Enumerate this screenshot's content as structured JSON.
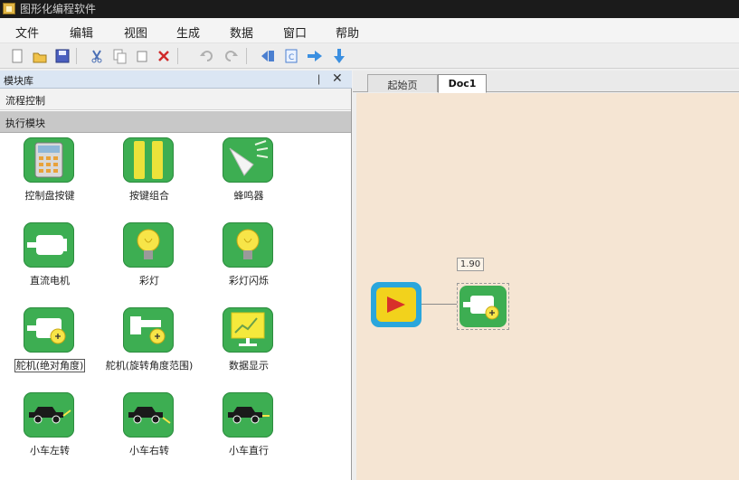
{
  "window": {
    "title": "图形化编程软件"
  },
  "menu": {
    "items": [
      "文件",
      "编辑",
      "视图",
      "生成",
      "数据",
      "窗口",
      "帮助"
    ]
  },
  "toolbar": {
    "buttons": [
      "new-file-icon",
      "open-file-icon",
      "save-icon",
      "cut-icon",
      "copy-icon",
      "paste-icon",
      "delete-icon",
      "undo-icon",
      "redo-icon",
      "import-icon",
      "export-icon",
      "arrow-right-icon",
      "arrow-down-icon"
    ]
  },
  "library": {
    "title": "模块库",
    "categories": [
      "流程控制",
      "执行模块"
    ],
    "modules": [
      {
        "label": "控制盘按键",
        "icon": "control-panel-icon"
      },
      {
        "label": "按键组合",
        "icon": "key-combo-icon"
      },
      {
        "label": "蜂鸣器",
        "icon": "buzzer-icon"
      },
      {
        "label": "直流电机",
        "icon": "dc-motor-icon"
      },
      {
        "label": "彩灯",
        "icon": "light-bulb-icon"
      },
      {
        "label": "彩灯闪烁",
        "icon": "light-blink-icon"
      },
      {
        "label": "舵机(绝对角度)",
        "icon": "servo-absolute-icon"
      },
      {
        "label": "舵机(旋转角度范围)",
        "icon": "servo-rotate-icon"
      },
      {
        "label": "数据显示",
        "icon": "data-display-icon"
      },
      {
        "label": "小车左转",
        "icon": "car-left-icon"
      },
      {
        "label": "小车右转",
        "icon": "car-right-icon"
      },
      {
        "label": "小车直行",
        "icon": "car-straight-icon"
      }
    ]
  },
  "tabs": [
    "起始页",
    "Doc1"
  ],
  "canvas": {
    "motor_param": "1.90"
  },
  "colors": {
    "tile_green": "#3dae52",
    "canvas_bg": "#f5e5d3",
    "start_blue": "#2aa6dc",
    "start_yellow": "#f2d21c",
    "play_red": "#d8312a"
  }
}
